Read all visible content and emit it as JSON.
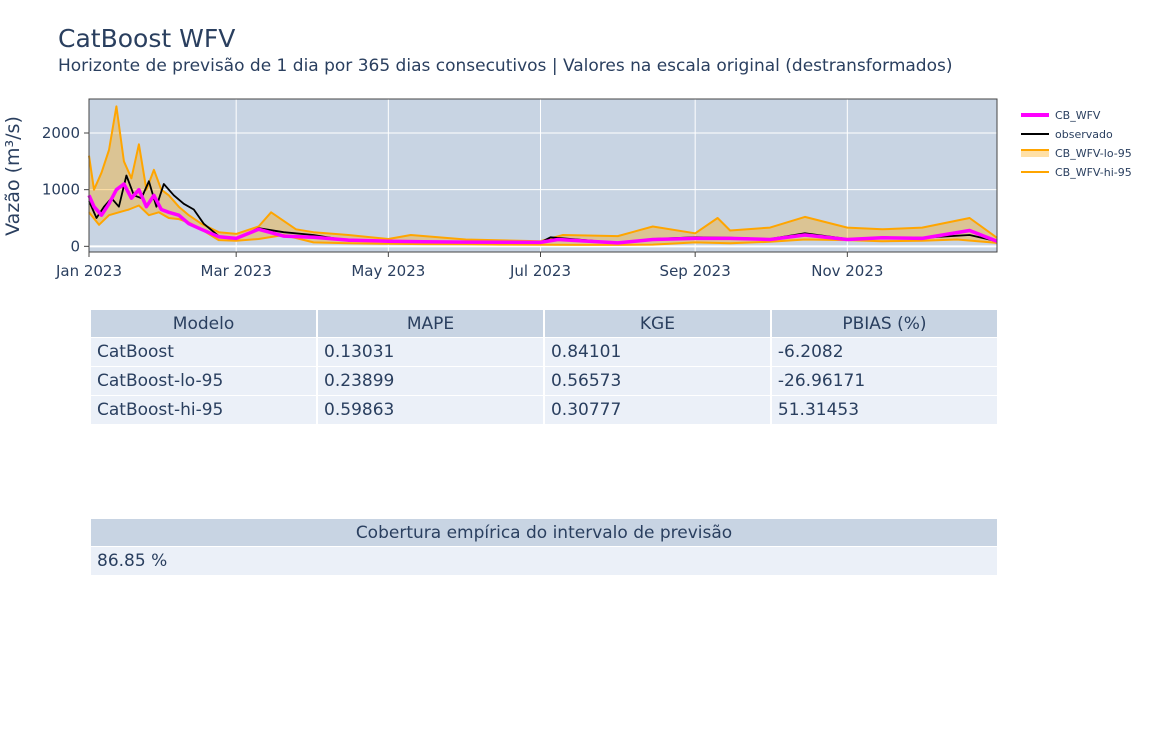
{
  "header": {
    "title": "CatBoost WFV",
    "subtitle": "Horizonte de previsão de 1 dia por 365 dias consecutivos | Valores na escala original (destransformados)"
  },
  "chart_data": {
    "type": "line",
    "ylabel": "Vazão (m³/s)",
    "xlabel": "",
    "x_range": [
      "2023-01-01",
      "2023-12-31"
    ],
    "ylim": [
      -100,
      2600
    ],
    "grid": true,
    "legend_position": "right",
    "x_ticks": [
      {
        "date": "2023-01-01",
        "label": "Jan 2023"
      },
      {
        "date": "2023-03-01",
        "label": "Mar 2023"
      },
      {
        "date": "2023-05-01",
        "label": "May 2023"
      },
      {
        "date": "2023-07-01",
        "label": "Jul 2023"
      },
      {
        "date": "2023-09-01",
        "label": "Sep 2023"
      },
      {
        "date": "2023-11-01",
        "label": "Nov 2023"
      }
    ],
    "y_ticks": [
      0,
      1000,
      2000
    ],
    "series": [
      {
        "name": "CB_WFV-lo-95",
        "color": "#ffa500",
        "fill": "rgba(255,165,0,0.35)",
        "x": [
          "2023-01-01",
          "2023-01-05",
          "2023-01-09",
          "2023-01-13",
          "2023-01-17",
          "2023-01-21",
          "2023-01-25",
          "2023-01-29",
          "2023-02-02",
          "2023-02-06",
          "2023-02-10",
          "2023-02-15",
          "2023-02-22",
          "2023-03-01",
          "2023-03-10",
          "2023-03-20",
          "2023-04-01",
          "2023-04-15",
          "2023-05-01",
          "2023-05-15",
          "2023-06-01",
          "2023-06-15",
          "2023-07-01",
          "2023-07-15",
          "2023-08-01",
          "2023-08-15",
          "2023-09-01",
          "2023-09-15",
          "2023-10-01",
          "2023-10-15",
          "2023-11-01",
          "2023-11-15",
          "2023-12-01",
          "2023-12-15",
          "2023-12-31"
        ],
        "y": [
          600,
          380,
          550,
          600,
          650,
          720,
          550,
          600,
          500,
          480,
          420,
          300,
          110,
          100,
          130,
          200,
          70,
          55,
          45,
          40,
          35,
          30,
          28,
          25,
          25,
          30,
          70,
          55,
          80,
          120,
          110,
          90,
          100,
          120,
          60
        ]
      },
      {
        "name": "CB_WFV-hi-95",
        "color": "#ffa500",
        "x": [
          "2023-01-01",
          "2023-01-03",
          "2023-01-06",
          "2023-01-09",
          "2023-01-12",
          "2023-01-15",
          "2023-01-18",
          "2023-01-21",
          "2023-01-24",
          "2023-01-27",
          "2023-01-30",
          "2023-02-02",
          "2023-02-06",
          "2023-02-10",
          "2023-02-15",
          "2023-02-22",
          "2023-03-01",
          "2023-03-10",
          "2023-03-15",
          "2023-03-25",
          "2023-04-01",
          "2023-04-15",
          "2023-05-01",
          "2023-05-10",
          "2023-06-01",
          "2023-07-01",
          "2023-07-10",
          "2023-08-01",
          "2023-08-15",
          "2023-09-01",
          "2023-09-10",
          "2023-09-15",
          "2023-10-01",
          "2023-10-15",
          "2023-11-01",
          "2023-11-15",
          "2023-12-01",
          "2023-12-20",
          "2023-12-31"
        ],
        "y": [
          1600,
          1000,
          1300,
          1700,
          2470,
          1500,
          1200,
          1800,
          1000,
          1350,
          1000,
          900,
          700,
          550,
          400,
          250,
          220,
          350,
          600,
          300,
          250,
          200,
          130,
          200,
          120,
          90,
          200,
          180,
          350,
          230,
          500,
          280,
          330,
          520,
          330,
          300,
          330,
          500,
          150
        ]
      },
      {
        "name": "observado",
        "color": "#000000",
        "x": [
          "2023-01-01",
          "2023-01-04",
          "2023-01-07",
          "2023-01-10",
          "2023-01-13",
          "2023-01-16",
          "2023-01-19",
          "2023-01-22",
          "2023-01-25",
          "2023-01-28",
          "2023-01-31",
          "2023-02-04",
          "2023-02-08",
          "2023-02-12",
          "2023-02-16",
          "2023-02-22",
          "2023-03-01",
          "2023-03-10",
          "2023-03-20",
          "2023-04-01",
          "2023-04-15",
          "2023-05-01",
          "2023-05-15",
          "2023-06-01",
          "2023-07-01",
          "2023-07-05",
          "2023-08-01",
          "2023-08-15",
          "2023-09-01",
          "2023-09-15",
          "2023-10-01",
          "2023-10-15",
          "2023-11-01",
          "2023-11-15",
          "2023-12-01",
          "2023-12-20",
          "2023-12-31"
        ],
        "y": [
          800,
          500,
          700,
          850,
          700,
          1250,
          900,
          850,
          1150,
          700,
          1100,
          900,
          750,
          650,
          400,
          180,
          130,
          320,
          250,
          200,
          100,
          90,
          80,
          75,
          70,
          160,
          60,
          130,
          160,
          150,
          130,
          230,
          130,
          160,
          150,
          200,
          90
        ]
      },
      {
        "name": "CB_WFV",
        "color": "#ff00ff",
        "x": [
          "2023-01-01",
          "2023-01-03",
          "2023-01-06",
          "2023-01-09",
          "2023-01-12",
          "2023-01-15",
          "2023-01-18",
          "2023-01-21",
          "2023-01-24",
          "2023-01-27",
          "2023-01-30",
          "2023-02-02",
          "2023-02-06",
          "2023-02-10",
          "2023-02-15",
          "2023-02-22",
          "2023-03-01",
          "2023-03-10",
          "2023-03-20",
          "2023-04-01",
          "2023-04-15",
          "2023-05-01",
          "2023-05-15",
          "2023-06-01",
          "2023-07-01",
          "2023-07-08",
          "2023-08-01",
          "2023-08-15",
          "2023-09-01",
          "2023-09-15",
          "2023-10-01",
          "2023-10-15",
          "2023-11-01",
          "2023-11-15",
          "2023-12-01",
          "2023-12-20",
          "2023-12-31"
        ],
        "y": [
          900,
          700,
          550,
          750,
          1000,
          1100,
          850,
          1000,
          700,
          900,
          650,
          600,
          550,
          400,
          300,
          170,
          140,
          300,
          180,
          160,
          110,
          90,
          80,
          75,
          70,
          120,
          60,
          120,
          140,
          140,
          120,
          200,
          120,
          150,
          140,
          280,
          90
        ]
      }
    ]
  },
  "metrics_table": {
    "columns": [
      "Modelo",
      "MAPE",
      "KGE",
      "PBIAS (%)"
    ],
    "rows": [
      [
        "CatBoost",
        "0.13031",
        "0.84101",
        "-6.2082"
      ],
      [
        "CatBoost-lo-95",
        "0.23899",
        "0.56573",
        "-26.96171"
      ],
      [
        "CatBoost-hi-95",
        "0.59863",
        "0.30777",
        "51.31453"
      ]
    ]
  },
  "coverage_table": {
    "columns": [
      "Cobertura empírica do intervalo de previsão"
    ],
    "rows": [
      [
        "86.85 %"
      ]
    ]
  }
}
